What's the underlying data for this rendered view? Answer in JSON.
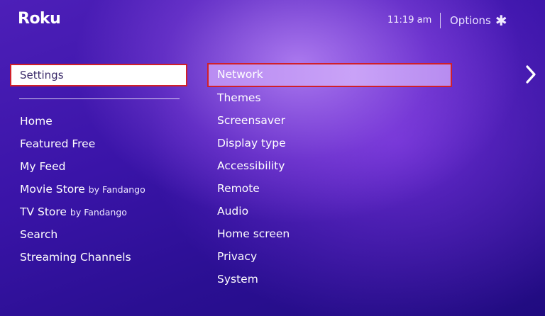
{
  "header": {
    "logo": "Roku",
    "time": "11:19 am",
    "options_label": "Options",
    "options_icon": "asterisk-icon"
  },
  "left_menu": {
    "selected": "Settings",
    "items": [
      {
        "label": "Home",
        "suffix": ""
      },
      {
        "label": "Featured Free",
        "suffix": ""
      },
      {
        "label": "My Feed",
        "suffix": ""
      },
      {
        "label": "Movie Store",
        "suffix": "by Fandango"
      },
      {
        "label": "TV Store",
        "suffix": "by Fandango"
      },
      {
        "label": "Search",
        "suffix": ""
      },
      {
        "label": "Streaming Channels",
        "suffix": ""
      }
    ]
  },
  "settings_menu": {
    "selected": "Network",
    "items": [
      "Themes",
      "Screensaver",
      "Display type",
      "Accessibility",
      "Remote",
      "Audio",
      "Home screen",
      "Privacy",
      "System"
    ]
  },
  "colors": {
    "highlight_border": "#d0202a",
    "background": "#3a14a8"
  },
  "icons": {
    "next": "chevron-right-icon"
  }
}
